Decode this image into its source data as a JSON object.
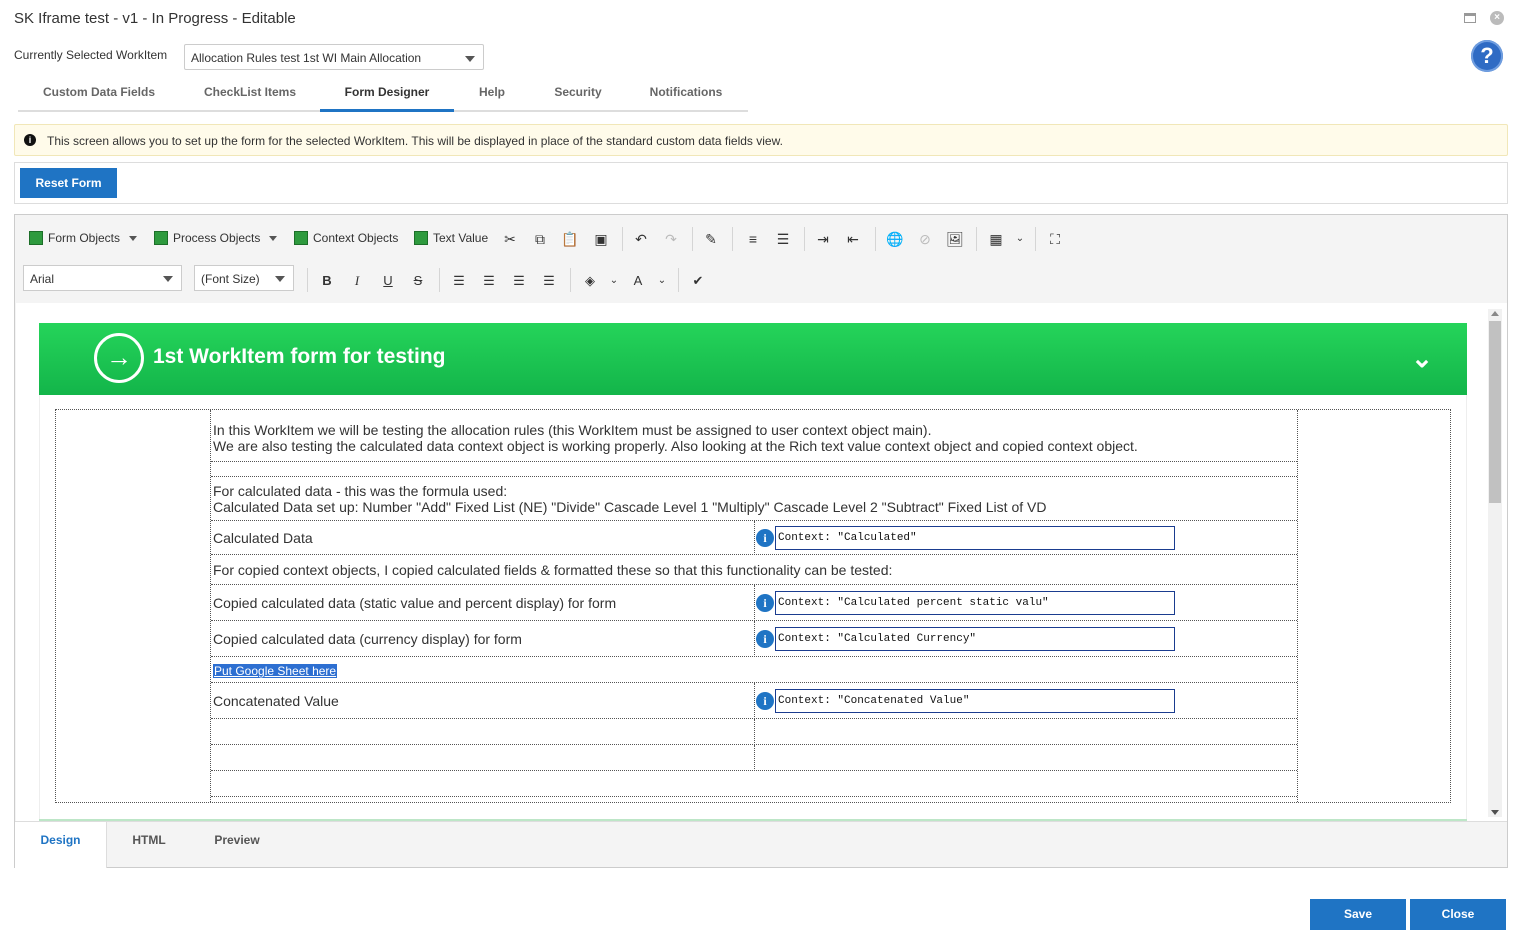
{
  "window": {
    "title": "SK Iframe test - v1 - In Progress - Editable"
  },
  "workitem": {
    "label": "Currently Selected WorkItem",
    "selected": "Allocation Rules test 1st WI Main Allocation"
  },
  "help": {
    "glyph": "?"
  },
  "tabs": [
    {
      "label": "Custom Data Fields"
    },
    {
      "label": "CheckList Items"
    },
    {
      "label": "Form Designer"
    },
    {
      "label": "Help"
    },
    {
      "label": "Security"
    },
    {
      "label": "Notifications"
    }
  ],
  "info": {
    "text": "This screen allows you to set up the form for the selected WorkItem. This will be displayed in place of the standard custom data fields view."
  },
  "reset_button": "Reset Form",
  "toolbar": {
    "form_objects": "Form Objects",
    "process_objects": "Process Objects",
    "context_objects": "Context Objects",
    "text_value": "Text Value",
    "font_name": "Arial",
    "font_size": "(Font Size)",
    "bold": "B",
    "italic": "I",
    "underline": "U",
    "strike": "S"
  },
  "form": {
    "banner_title": "1st WorkItem form for testing",
    "intro_line1": "In this WorkItem we will be testing the allocation rules (this WorkItem must be assigned to user context object main).",
    "intro_line2": "We are also testing the calculated data context object is working properly. Also looking at the Rich text value context object and copied context object.",
    "formula_line1": "For calculated data - this was the formula used:",
    "formula_line2": "Calculated Data set up: Number \"Add\" Fixed List (NE) \"Divide\" Cascade Level 1 \"Multiply\" Cascade Level 2 \"Subtract\" Fixed List of VD",
    "calc_label": "Calculated Data",
    "calc_ctx": "Context: \"Calculated\"",
    "copied_intro": "For copied context objects, I copied calculated fields & formatted these so that this functionality can be tested:",
    "copied_static_label": "Copied calculated data (static value and percent display) for form",
    "copied_static_ctx": "Context: \"Calculated percent static valu\"",
    "copied_currency_label": "Copied calculated data (currency display) for form",
    "copied_currency_ctx": "Context: \"Calculated Currency\"",
    "google_sheet": "Put Google Sheet here",
    "concat_label": "Concatenated Value",
    "concat_ctx": "Context: \"Concatenated Value\""
  },
  "editor_tabs": [
    {
      "label": "Design"
    },
    {
      "label": "HTML"
    },
    {
      "label": "Preview"
    }
  ],
  "footer": {
    "save": "Save",
    "close": "Close"
  },
  "colors": {
    "accent": "#1f74c4",
    "banner": "#19c452",
    "info_bg": "#fffbea"
  }
}
